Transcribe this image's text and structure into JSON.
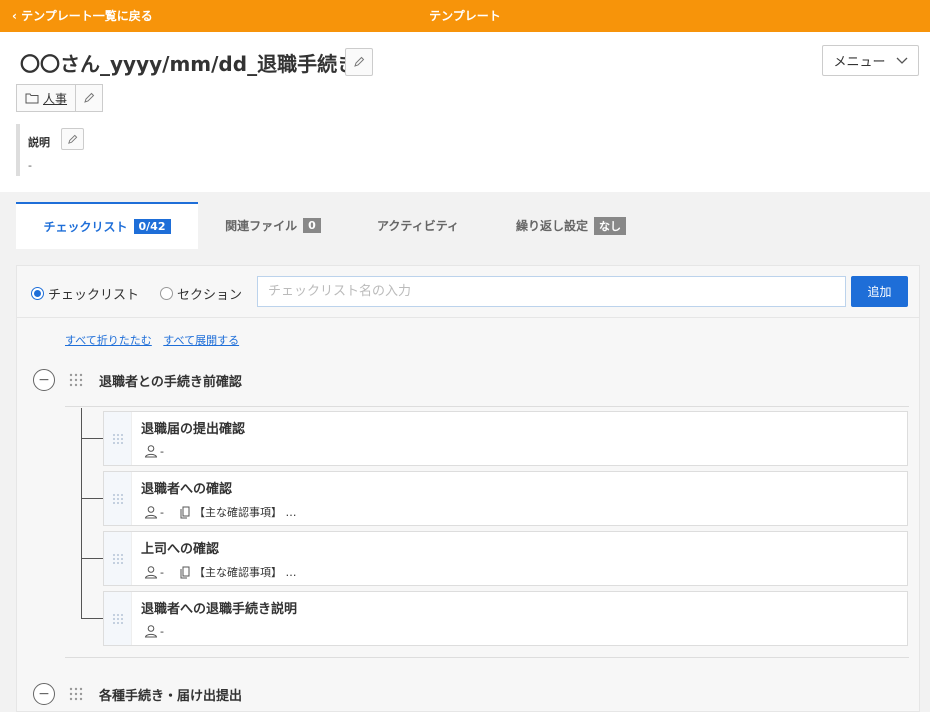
{
  "topbar": {
    "back_label": "テンプレート一覧に戻る",
    "title": "テンプレート",
    "color": "#f7940a"
  },
  "header": {
    "page_title": "〇〇さん_yyyy/mm/dd_退職手続き",
    "menu_label": "メニュー",
    "folder_label": "人事",
    "description_label": "説明",
    "description_value": "-"
  },
  "tabs": [
    {
      "label": "チェックリスト",
      "badge": "0/42",
      "active": true
    },
    {
      "label": "関連ファイル",
      "badge": "0",
      "active": false
    },
    {
      "label": "アクティビティ",
      "badge": "",
      "active": false
    },
    {
      "label": "繰り返し設定",
      "badge": "なし",
      "active": false
    }
  ],
  "add_row": {
    "radio_checklist": "チェックリスト",
    "radio_section": "セクション",
    "input_placeholder": "チェックリスト名の入力",
    "input_value": "",
    "add_button": "追加"
  },
  "links": {
    "collapse_all": "すべて折りたたむ",
    "expand_all": "すべて展開する"
  },
  "sections": [
    {
      "title": "退職者との手続き前確認",
      "items": [
        {
          "title": "退職届の提出確認",
          "assignee": "-",
          "note": ""
        },
        {
          "title": "退職者への確認",
          "assignee": "-",
          "note": "【主な確認事項】 …"
        },
        {
          "title": "上司への確認",
          "assignee": "-",
          "note": "【主な確認事項】 …"
        },
        {
          "title": "退職者への退職手続き説明",
          "assignee": "-",
          "note": ""
        }
      ]
    },
    {
      "title": "各種手続き・届け出提出",
      "items": []
    }
  ],
  "colors": {
    "accent": "#1e6ed8",
    "brand": "#f7940a"
  }
}
